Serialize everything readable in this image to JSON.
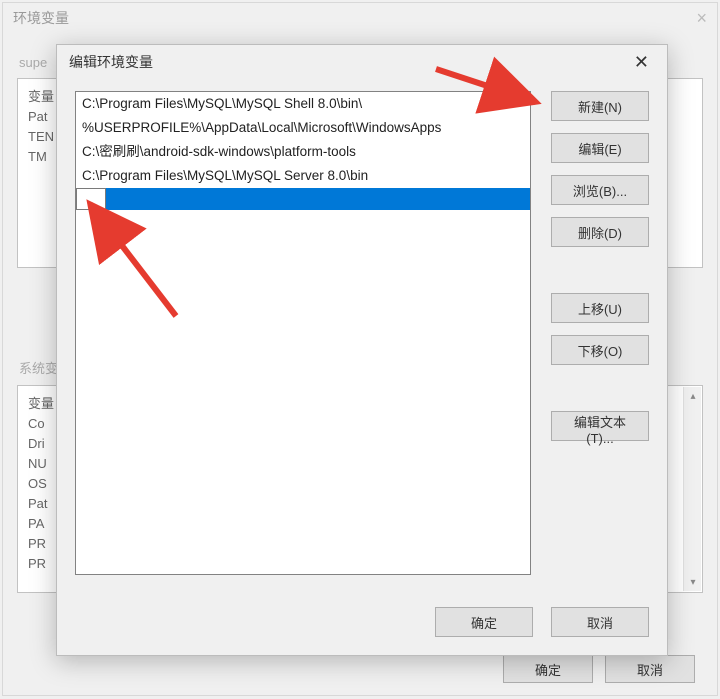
{
  "parent": {
    "title": "环境变量",
    "section1_label": "supe",
    "section2_label": "系统变",
    "rows1": [
      "变量",
      "Pat",
      "TEN",
      "TM"
    ],
    "rows2": [
      "变量",
      "Co",
      "Dri",
      "NU",
      "OS",
      "Pat",
      "PA",
      "PR",
      "PR"
    ],
    "ok": "确定",
    "cancel": "取消"
  },
  "dialog": {
    "title": "编辑环境变量",
    "paths": [
      "C:\\Program Files\\MySQL\\MySQL Shell 8.0\\bin\\",
      "%USERPROFILE%\\AppData\\Local\\Microsoft\\WindowsApps",
      "C:\\密刷刷\\android-sdk-windows\\platform-tools",
      "C:\\Program Files\\MySQL\\MySQL Server 8.0\\bin"
    ],
    "editing_value": "",
    "buttons": {
      "new": "新建(N)",
      "edit": "编辑(E)",
      "browse": "浏览(B)...",
      "delete": "删除(D)",
      "moveup": "上移(U)",
      "movedown": "下移(O)",
      "edittext": "编辑文本(T)..."
    },
    "ok": "确定",
    "cancel": "取消"
  }
}
